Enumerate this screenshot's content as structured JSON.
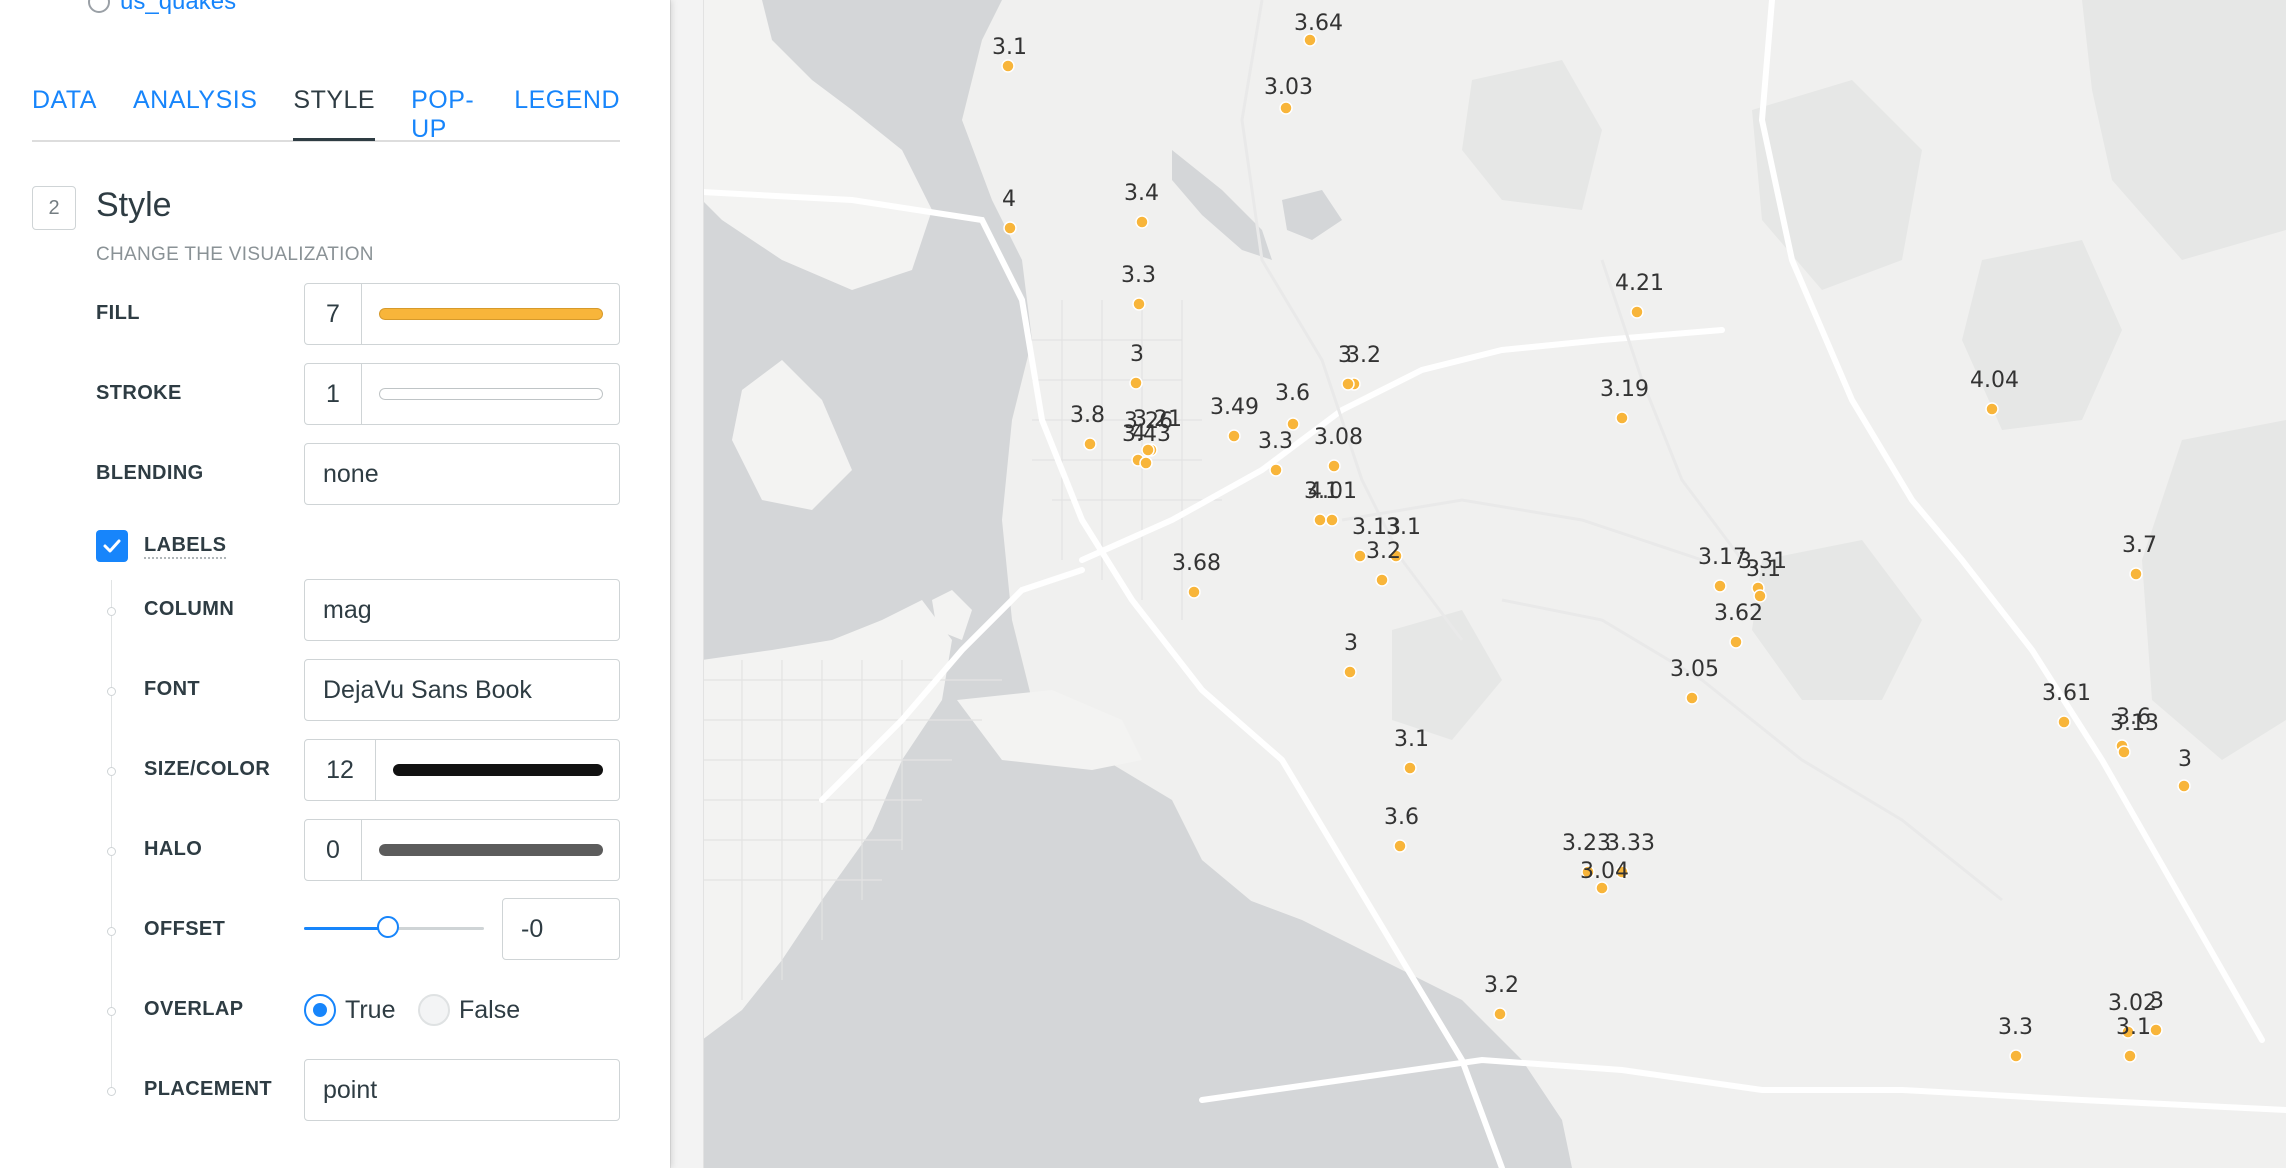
{
  "dataset": {
    "name": "us_quakes"
  },
  "tabs": [
    {
      "label": "DATA",
      "active": false
    },
    {
      "label": "ANALYSIS",
      "active": false
    },
    {
      "label": "STYLE",
      "active": true
    },
    {
      "label": "POP-UP",
      "active": false
    },
    {
      "label": "LEGEND",
      "active": false
    }
  ],
  "section": {
    "number": "2",
    "title": "Style",
    "subtitle": "CHANGE THE VISUALIZATION"
  },
  "style": {
    "fill": {
      "label": "FILL",
      "value": "7",
      "color": "#f8b53a"
    },
    "stroke": {
      "label": "STROKE",
      "value": "1",
      "color": "#ffffff"
    },
    "blending": {
      "label": "BLENDING",
      "value": "none"
    }
  },
  "labels": {
    "label": "LABELS",
    "checked": true,
    "column": {
      "label": "COLUMN",
      "value": "mag"
    },
    "font": {
      "label": "FONT",
      "value": "DejaVu Sans Book"
    },
    "size_color": {
      "label": "SIZE/COLOR",
      "value": "12",
      "color": "#111111"
    },
    "halo": {
      "label": "HALO",
      "value": "0",
      "color": "#555555"
    },
    "offset": {
      "label": "OFFSET",
      "value": "-0",
      "slider_fraction": 0.5
    },
    "overlap": {
      "label": "OVERLAP",
      "options": [
        "True",
        "False"
      ],
      "selected": "True"
    },
    "placement": {
      "label": "PLACEMENT",
      "value": "point"
    }
  },
  "map": {
    "point_color": "#f8b53a",
    "quakes": [
      {
        "mag": "3.1"
      },
      {
        "mag": "3.64"
      },
      {
        "mag": "3.03"
      },
      {
        "mag": "4"
      },
      {
        "mag": "3.4"
      },
      {
        "mag": "3.3"
      },
      {
        "mag": "4.21"
      },
      {
        "mag": "3"
      },
      {
        "mag": "3.2"
      },
      {
        "mag": "3.19"
      },
      {
        "mag": "4.04"
      },
      {
        "mag": "3.8"
      },
      {
        "mag": "4"
      },
      {
        "mag": "3.21"
      },
      {
        "mag": "3.26"
      },
      {
        "mag": "3.43"
      },
      {
        "mag": "3.49"
      },
      {
        "mag": "3.6"
      },
      {
        "mag": "3.3"
      },
      {
        "mag": "3.08"
      },
      {
        "mag": "3"
      },
      {
        "mag": "3.1"
      },
      {
        "mag": "4.01"
      },
      {
        "mag": "3.13"
      },
      {
        "mag": "3.1"
      },
      {
        "mag": "3.2"
      },
      {
        "mag": "3.68"
      },
      {
        "mag": "3.17"
      },
      {
        "mag": "3.31"
      },
      {
        "mag": "3.1"
      },
      {
        "mag": "3.62"
      },
      {
        "mag": "3.7"
      },
      {
        "mag": "3"
      },
      {
        "mag": "3.05"
      },
      {
        "mag": "3.61"
      },
      {
        "mag": "3.6"
      },
      {
        "mag": "3.13"
      },
      {
        "mag": "3"
      },
      {
        "mag": "3.1"
      },
      {
        "mag": "3.6"
      },
      {
        "mag": "3.23"
      },
      {
        "mag": "3.33"
      },
      {
        "mag": "3.04"
      },
      {
        "mag": "3.2"
      },
      {
        "mag": "3.3"
      },
      {
        "mag": "3.02"
      },
      {
        "mag": "3"
      },
      {
        "mag": "3.1"
      }
    ]
  }
}
